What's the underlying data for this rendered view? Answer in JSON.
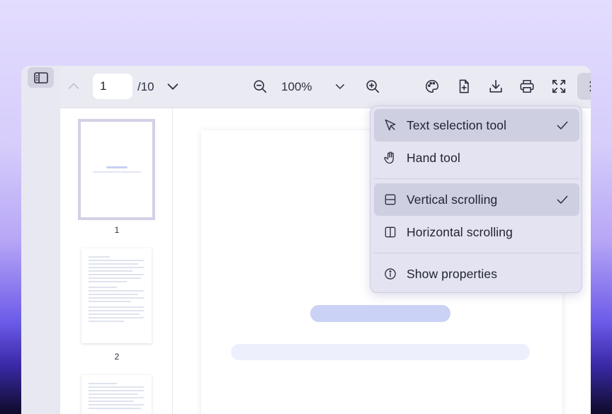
{
  "toolbar": {
    "page_value": "1",
    "page_total": "/10",
    "zoom_value": "100%"
  },
  "thumbnails": [
    {
      "label": "1",
      "selected": true
    },
    {
      "label": "2",
      "selected": false
    }
  ],
  "menu": {
    "items": [
      {
        "label": "Text selection tool",
        "icon": "cursor-arrow-icon",
        "checked": true
      },
      {
        "label": "Hand tool",
        "icon": "hand-icon",
        "checked": false
      },
      {
        "label": "Vertical scrolling",
        "icon": "vertical-scroll-icon",
        "checked": true
      },
      {
        "label": "Horizontal scrolling",
        "icon": "horizontal-scroll-icon",
        "checked": false
      },
      {
        "label": "Show properties",
        "icon": "info-icon",
        "checked": false
      }
    ]
  },
  "colors": {
    "accent_bar": "#cad2f5",
    "menu_bg": "#e3e3f1",
    "active_item": "#cfcfe2"
  }
}
